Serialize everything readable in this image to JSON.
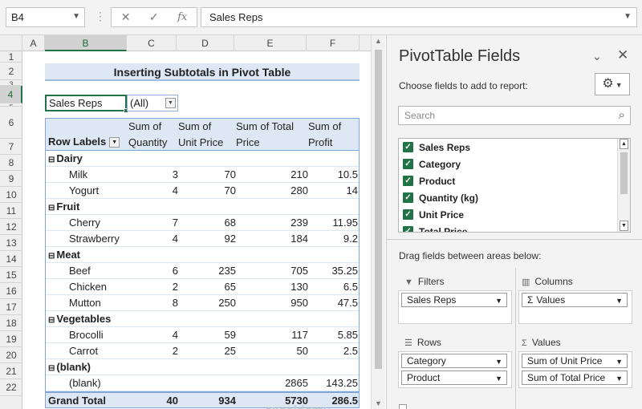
{
  "formula_bar": {
    "name_box": "B4",
    "cancel": "✕",
    "enter": "✓",
    "fx": "fx",
    "content": "Sales Reps"
  },
  "grid": {
    "columns": [
      "A",
      "B",
      "C",
      "D",
      "E",
      "F"
    ],
    "rows": [
      "1",
      "2",
      "3",
      "4",
      "5",
      "6",
      "7",
      "8",
      "9",
      "10",
      "11",
      "12",
      "13",
      "14",
      "15",
      "16",
      "17",
      "18",
      "19",
      "20",
      "21",
      "22"
    ],
    "row4": "4"
  },
  "sheet": {
    "title": "Inserting Subtotals in Pivot Table",
    "filter_label": "Sales Reps",
    "filter_value": "(All)"
  },
  "pivot": {
    "headers": {
      "row_labels": "Row Labels",
      "qty": [
        "Sum of",
        "Quantity"
      ],
      "unit": [
        "Sum of",
        "Unit Price"
      ],
      "total": [
        "Sum of Total",
        "Price"
      ],
      "profit": [
        "Sum of",
        "Profit"
      ]
    },
    "rows": [
      {
        "type": "group",
        "label": "Dairy"
      },
      {
        "type": "item",
        "label": "Milk",
        "qty": "3",
        "unit": "70",
        "total": "210",
        "profit": "10.5"
      },
      {
        "type": "item",
        "label": "Yogurt",
        "qty": "4",
        "unit": "70",
        "total": "280",
        "profit": "14"
      },
      {
        "type": "group",
        "label": "Fruit"
      },
      {
        "type": "item",
        "label": "Cherry",
        "qty": "7",
        "unit": "68",
        "total": "239",
        "profit": "11.95"
      },
      {
        "type": "item",
        "label": "Strawberry",
        "qty": "4",
        "unit": "92",
        "total": "184",
        "profit": "9.2"
      },
      {
        "type": "group",
        "label": "Meat"
      },
      {
        "type": "item",
        "label": "Beef",
        "qty": "6",
        "unit": "235",
        "total": "705",
        "profit": "35.25"
      },
      {
        "type": "item",
        "label": "Chicken",
        "qty": "2",
        "unit": "65",
        "total": "130",
        "profit": "6.5"
      },
      {
        "type": "item",
        "label": "Mutton",
        "qty": "8",
        "unit": "250",
        "total": "950",
        "profit": "47.5"
      },
      {
        "type": "group",
        "label": "Vegetables"
      },
      {
        "type": "item",
        "label": "Brocolli",
        "qty": "4",
        "unit": "59",
        "total": "117",
        "profit": "5.85"
      },
      {
        "type": "item",
        "label": "Carrot",
        "qty": "2",
        "unit": "25",
        "total": "50",
        "profit": "2.5"
      },
      {
        "type": "group",
        "label": "(blank)"
      },
      {
        "type": "item",
        "label": "(blank)",
        "qty": "",
        "unit": "",
        "total": "2865",
        "profit": "143.25"
      }
    ],
    "grand_total": {
      "label": "Grand Total",
      "qty": "40",
      "unit": "934",
      "total": "5730",
      "profit": "286.5"
    }
  },
  "watermark": "exceldemy",
  "pane": {
    "title": "PivotTable Fields",
    "choose": "Choose fields to add to report:",
    "search_placeholder": "Search",
    "fields": [
      "Sales Reps",
      "Category",
      "Product",
      "Quantity (kg)",
      "Unit Price",
      "Total Price"
    ],
    "drag": "Drag fields between areas below:",
    "filters_label": "Filters",
    "columns_label": "Columns",
    "rows_label": "Rows",
    "values_label": "Values",
    "filters": [
      "Sales Reps"
    ],
    "columns": [
      "Values"
    ],
    "rows": [
      "Category",
      "Product"
    ],
    "values": [
      "Sum of Unit Price",
      "Sum of Total Price"
    ]
  },
  "colors": {
    "accent": "#217346",
    "pivot_header": "#dde8f4",
    "pivot_border": "#7ea6d8"
  }
}
